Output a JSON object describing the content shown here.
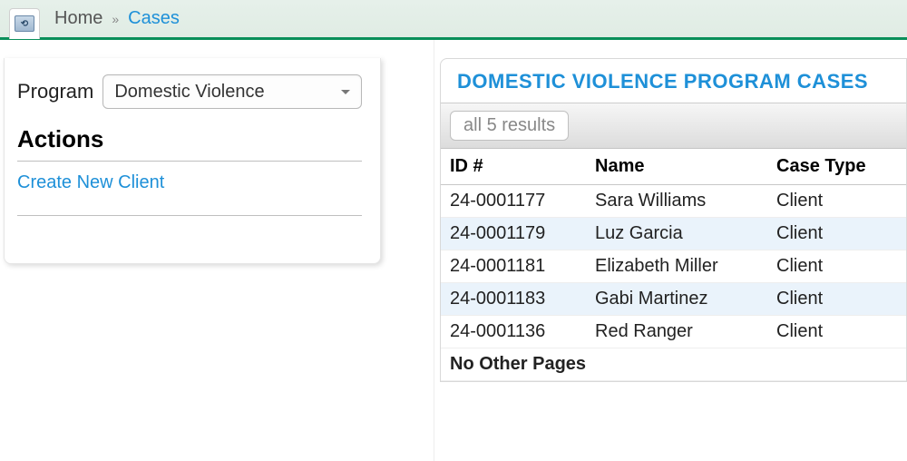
{
  "breadcrumb": {
    "home": "Home",
    "separator": "»",
    "current": "Cases"
  },
  "sidebar": {
    "program_label": "Program",
    "program_selected": "Domestic Violence",
    "actions_heading": "Actions",
    "actions": [
      {
        "label": "Create New Client"
      }
    ]
  },
  "main": {
    "tab_title": "DOMESTIC VIOLENCE PROGRAM CASES",
    "results_button": "all 5 results",
    "columns": {
      "id": "ID #",
      "name": "Name",
      "case_type": "Case Type"
    },
    "rows": [
      {
        "id": "24-0001177",
        "name": "Sara Williams",
        "case_type": "Client"
      },
      {
        "id": "24-0001179",
        "name": "Luz Garcia",
        "case_type": "Client"
      },
      {
        "id": "24-0001181",
        "name": "Elizabeth Miller",
        "case_type": "Client"
      },
      {
        "id": "24-0001183",
        "name": "Gabi Martinez",
        "case_type": "Client"
      },
      {
        "id": "24-0001136",
        "name": "Red Ranger",
        "case_type": "Client"
      }
    ],
    "footer": "No Other Pages"
  }
}
